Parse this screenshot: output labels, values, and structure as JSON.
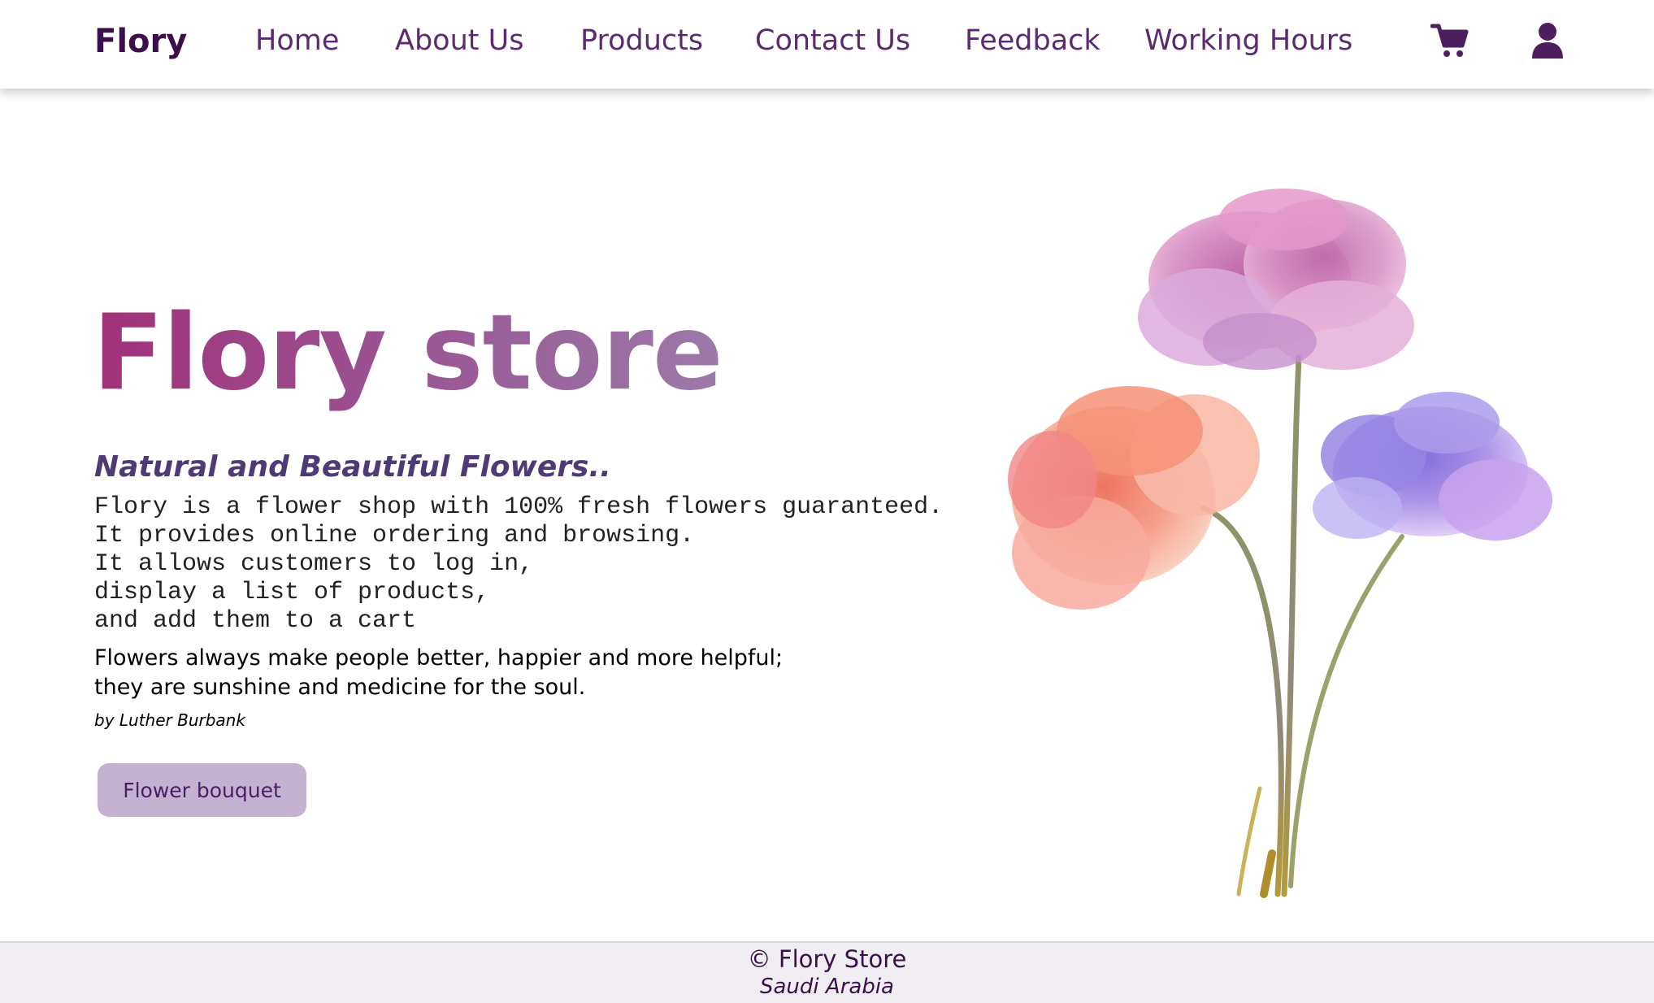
{
  "navbar": {
    "brand": "Flory",
    "links": [
      "Home",
      "About Us",
      "Products",
      "Contact Us",
      "Feedback",
      "Working Hours"
    ],
    "icons": [
      "cart-icon",
      "user-icon"
    ]
  },
  "hero": {
    "title": "Flory store",
    "tagline": "Natural and Beautiful Flowers..",
    "description": "Flory is a flower shop with 100% fresh flowers guaranteed.\nIt provides online ordering and browsing.\nIt allows customers to log in,\ndisplay a list of products,\nand add them to a cart",
    "quote": "Flowers always make people better, happier and more helpful;\nthey are sunshine and medicine for the soul.",
    "quote_author": "by Luther Burbank",
    "button_label": "Flower bouquet"
  },
  "footer": {
    "copyright": "© Flory Store",
    "country": "Saudi Arabia"
  },
  "colors": {
    "brand": "#3b0f4a",
    "nav_link": "#5b2a6f",
    "title_gradient_start": "#a1307a",
    "title_gradient_end": "#9b7aa8",
    "button_bg": "#c4b3d0",
    "footer_bg": "#f0eef2"
  }
}
